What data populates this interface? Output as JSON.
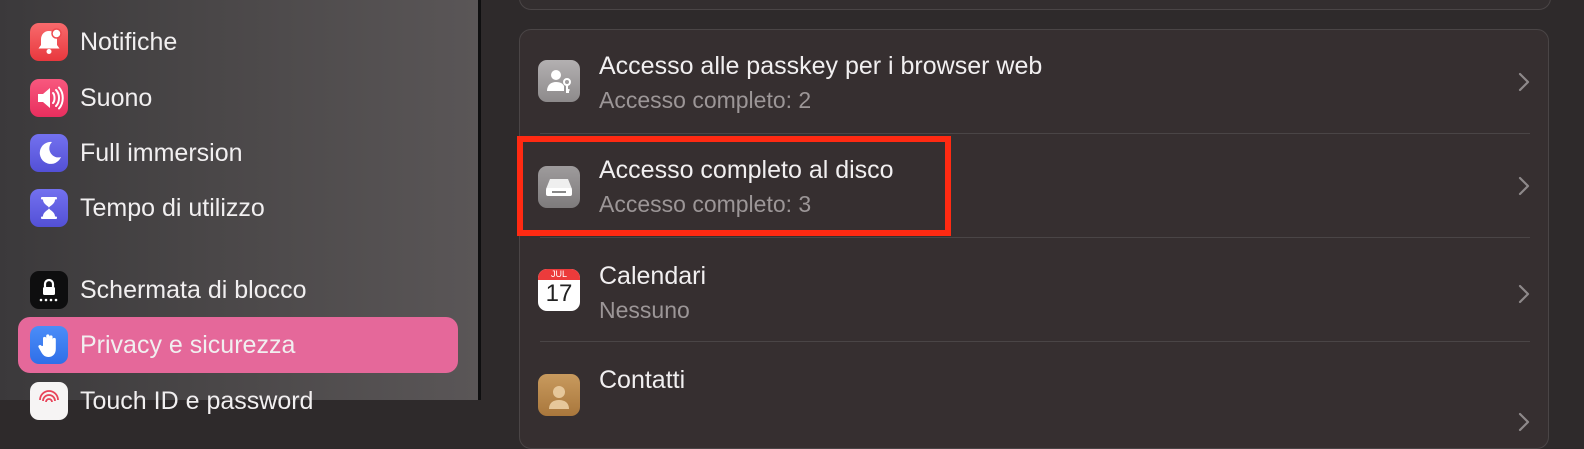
{
  "sidebar": {
    "items": [
      {
        "label": "Notifiche",
        "icon": "bell-icon",
        "color": "#f0484e"
      },
      {
        "label": "Suono",
        "icon": "speaker-icon",
        "color": "#f03a6a"
      },
      {
        "label": "Full immersion",
        "icon": "moon-icon",
        "color": "#5c5be0"
      },
      {
        "label": "Tempo di utilizzo",
        "icon": "hourglass-icon",
        "color": "#5c5be0"
      },
      {
        "label": "Schermata di blocco",
        "icon": "lock-screen-icon",
        "color": "#111111"
      },
      {
        "label": "Privacy e sicurezza",
        "icon": "hand-icon",
        "color": "#3d7ff6",
        "selected": true
      },
      {
        "label": "Touch ID e password",
        "icon": "fingerprint-icon",
        "color": "#f5f5f5"
      }
    ]
  },
  "main": {
    "rows": [
      {
        "title": "Accesso alle passkey per i browser web",
        "subtitle": "Accesso completo: 2",
        "icon": "passkey-user-icon"
      },
      {
        "title": "Accesso completo al disco",
        "subtitle": "Accesso completo: 3",
        "icon": "disk-drive-icon"
      },
      {
        "title": "Calendari",
        "subtitle": "Nessuno",
        "icon": "calendar-icon",
        "calendar_month": "JUL",
        "calendar_day": "17"
      },
      {
        "title": "Contatti",
        "subtitle": "",
        "icon": "contacts-icon"
      }
    ]
  },
  "colors": {
    "selection": "#e5689a",
    "highlight_box": "#ff2a12",
    "background": "#2e2a2b"
  }
}
